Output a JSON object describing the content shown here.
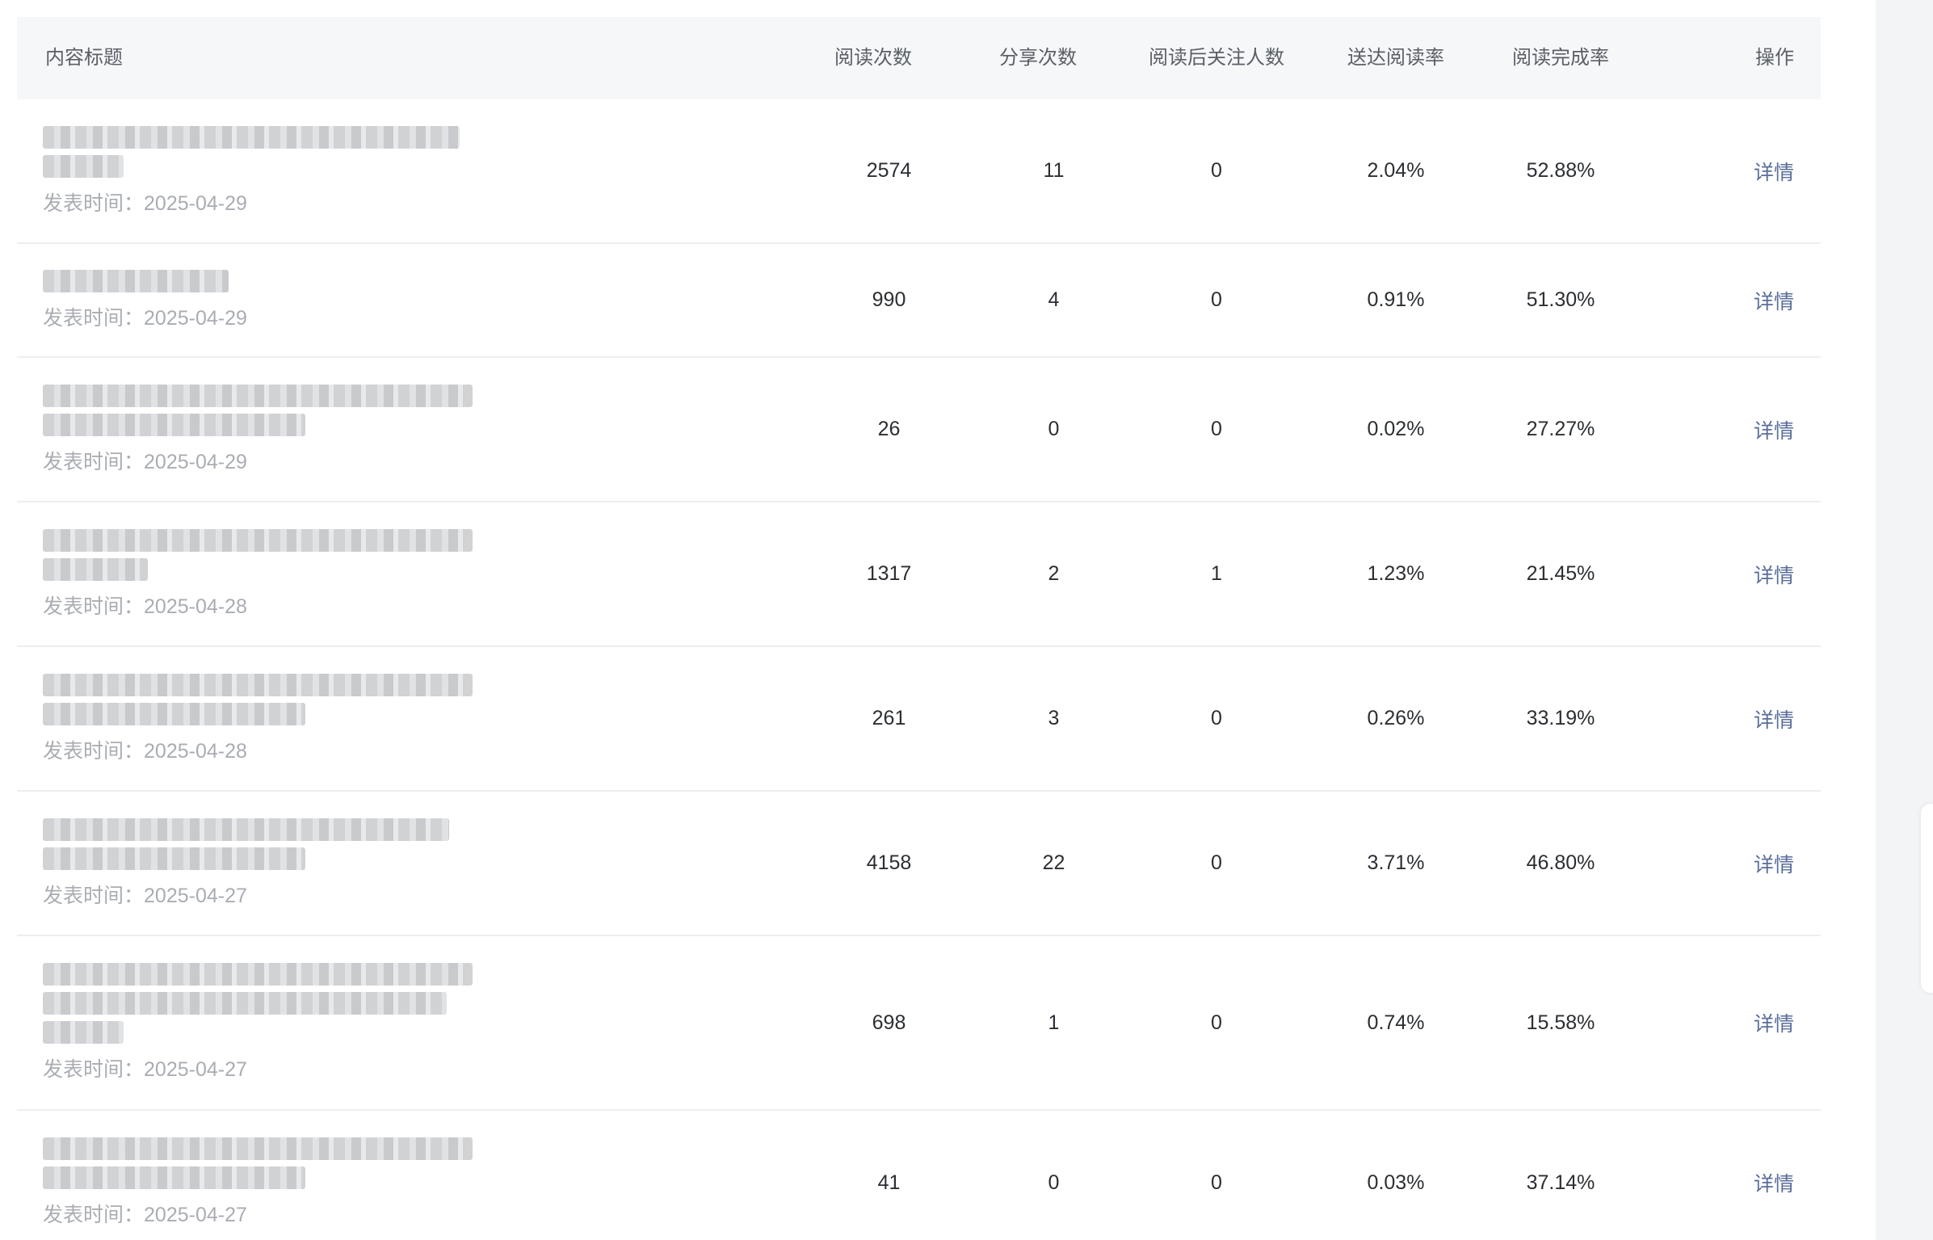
{
  "columns": {
    "title": "内容标题",
    "reads": "阅读次数",
    "shares": "分享次数",
    "follows": "阅读后关注人数",
    "reach_rate": "送达阅读率",
    "completion": "阅读完成率",
    "action": "操作"
  },
  "publish_label": "发表时间：",
  "rows": [
    {
      "date": "2025-04-29",
      "reads": "2574",
      "shares": "11",
      "follows": "0",
      "reach_rate": "2.04%",
      "completion": "52.88%",
      "action": "详情"
    },
    {
      "date": "2025-04-29",
      "reads": "990",
      "shares": "4",
      "follows": "0",
      "reach_rate": "0.91%",
      "completion": "51.30%",
      "action": "详情"
    },
    {
      "date": "2025-04-29",
      "reads": "26",
      "shares": "0",
      "follows": "0",
      "reach_rate": "0.02%",
      "completion": "27.27%",
      "action": "详情"
    },
    {
      "date": "2025-04-28",
      "reads": "1317",
      "shares": "2",
      "follows": "1",
      "reach_rate": "1.23%",
      "completion": "21.45%",
      "action": "详情"
    },
    {
      "date": "2025-04-28",
      "reads": "261",
      "shares": "3",
      "follows": "0",
      "reach_rate": "0.26%",
      "completion": "33.19%",
      "action": "详情"
    },
    {
      "date": "2025-04-27",
      "reads": "4158",
      "shares": "22",
      "follows": "0",
      "reach_rate": "3.71%",
      "completion": "46.80%",
      "action": "详情"
    },
    {
      "date": "2025-04-27",
      "reads": "698",
      "shares": "1",
      "follows": "0",
      "reach_rate": "0.74%",
      "completion": "15.58%",
      "action": "详情"
    },
    {
      "date": "2025-04-27",
      "reads": "41",
      "shares": "0",
      "follows": "0",
      "reach_rate": "0.03%",
      "completion": "37.14%",
      "action": "详情"
    }
  ],
  "colors": {
    "header_bg": "#f6f7f9",
    "link": "#5a6e9a",
    "muted": "#a9adb3",
    "divider": "#eceef1"
  }
}
